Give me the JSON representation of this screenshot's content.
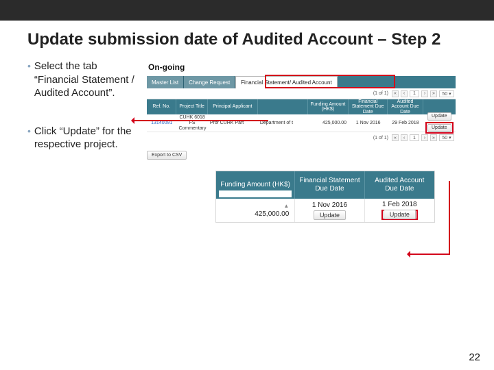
{
  "title": "Update submission date of Audited Account – Step 2",
  "bullets": [
    "Select the tab “Financial Statement / Audited Account”.",
    "Click “Update” for the respective project."
  ],
  "top": {
    "heading": "On-going",
    "tabs": [
      "Master List",
      "Change Request",
      "Financial Statement/ Audited Account"
    ],
    "pager": {
      "label": "(1 of 1)",
      "page": "1",
      "perpage": "50 ▾"
    },
    "cols": [
      "Ref. No.",
      "Project Title",
      "Principal Applicant",
      "",
      "Funding Amount (HK$)",
      "Financial Statement Due Date",
      "Audited Account Due Date",
      ""
    ],
    "row": {
      "ref": "13140091",
      "title": "CUHK 6018 FS Commentary",
      "pa": "Prof CUHK Part",
      "dept": "Department of t",
      "amount": "425,000.00",
      "fsd": "1 Nov 2016",
      "aad": "29 Feb 2018",
      "btn1": "Update",
      "btn2": "Update"
    },
    "export": "Export to CSV"
  },
  "bottom": {
    "cols": [
      "Funding Amount (HK$)",
      "Financial Statement Due Date",
      "Audited Account Due Date"
    ],
    "row": {
      "amount": "425,000.00",
      "sort": "▲",
      "fsd": "1 Nov 2016",
      "aad": "1 Feb 2018",
      "btn1": "Update",
      "btn2": "Update"
    }
  },
  "page_number": "22"
}
